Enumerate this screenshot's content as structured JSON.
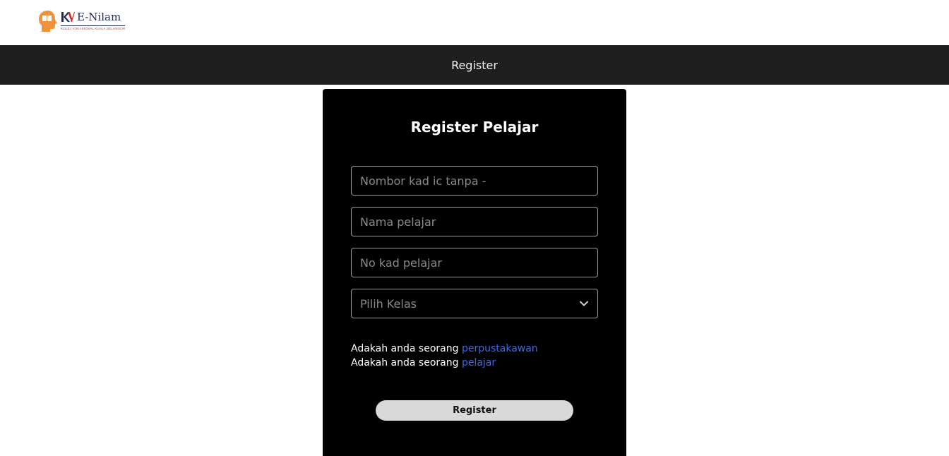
{
  "header": {
    "logo_title": "E-Nilam",
    "logo_subtitle": "KOLEJ VOKASIONAL KUALA SELANGOR",
    "logo_icon": "head-book-icon"
  },
  "navbar": {
    "link_label": "Register"
  },
  "form": {
    "title": "Register Pelajar",
    "ic_placeholder": "Nombor kad ic tanpa -",
    "name_placeholder": "Nama pelajar",
    "card_placeholder": "No kad pelajar",
    "class_select": "Pilih Kelas",
    "line1_prefix": "Adakah anda seorang ",
    "line1_link": "perpustakawan",
    "line2_prefix": "Adakah anda seorang ",
    "line2_link": "pelajar",
    "submit_label": "Register"
  },
  "colors": {
    "navbar_bg": "#1f1f1f",
    "card_bg": "#000000",
    "link": "#3b6ae8",
    "button_bg": "#d9d9d9"
  }
}
